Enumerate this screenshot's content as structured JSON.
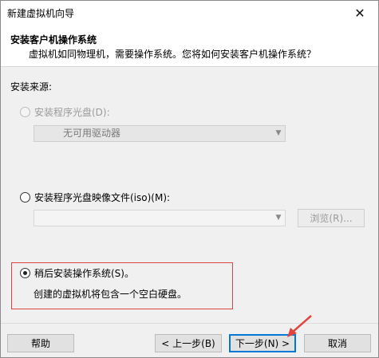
{
  "window": {
    "title": "新建虚拟机向导",
    "close_glyph": "✕"
  },
  "header": {
    "title": "安装客户机操作系统",
    "description": "虚拟机如同物理机，需要操作系统。您将如何安装客户机操作系统？"
  },
  "install_source": {
    "label": "安装来源:",
    "disc": {
      "label": "安装程序光盘(D):",
      "selected": false,
      "disabled": true
    },
    "disc_drive": {
      "value": "无可用驱动器"
    },
    "iso": {
      "label": "安装程序光盘映像文件(iso)(M):",
      "selected": false
    },
    "iso_path": {
      "value": ""
    },
    "browse_label": "浏览(R)...",
    "later": {
      "label": "稍后安装操作系统(S)。",
      "selected": true
    },
    "later_desc": "创建的虚拟机将包含一个空白硬盘。"
  },
  "buttons": {
    "help": "帮助",
    "back": "< 上一步(B)",
    "next": "下一步(N) >",
    "cancel": "取消"
  },
  "colors": {
    "highlight": "#e0443e",
    "accent": "#0078d7"
  }
}
